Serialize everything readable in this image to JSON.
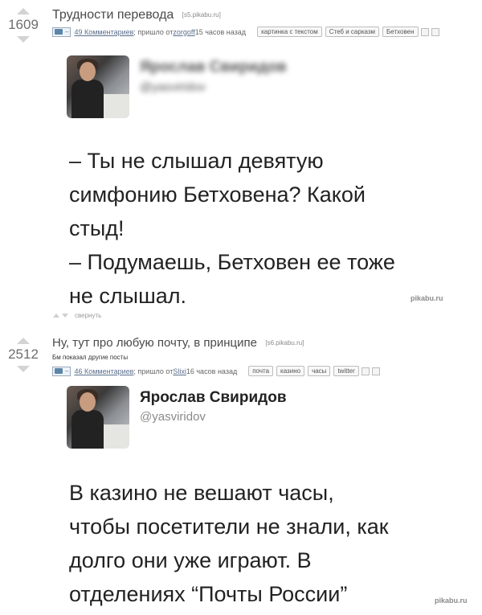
{
  "posts": [
    {
      "rating": "1609",
      "title": "Трудности перевода",
      "source": "[s5.pikabu.ru]",
      "comments": "49 Комментариев",
      "meta_mid": "; пришло от ",
      "author": "zorgoff",
      "time": " 15 часов назад",
      "tags": [
        "картинка с текстом",
        "Стеб и сарказм",
        "Бетховен"
      ],
      "tweet_name": "Ярослав Свиридов",
      "tweet_handle": "@yasviridov",
      "tweet_lines": [
        "– Ты не слышал девятую",
        "симфонию Бетховена? Какой",
        "стыд!",
        "– Подумаешь, Бетховен ее тоже",
        "не слышал."
      ],
      "watermark": "pikabu.ru",
      "collapse": "свернуть"
    },
    {
      "rating": "2512",
      "title": "Ну, тут про любую почту, в принципе",
      "source": "[s6.pikabu.ru]",
      "note": "Бм показал другие посты",
      "comments": "46 Комментариев",
      "meta_mid": "; пришло от ",
      "author": "Slixi",
      "time": " 16 часов назад",
      "tags": [
        "почта",
        "казино",
        "часы",
        "twitter"
      ],
      "tweet_name": "Ярослав Свиридов",
      "tweet_handle": "@yasviridov",
      "tweet_lines": [
        "В казино не вешают часы,",
        "чтобы посетители не знали, как",
        "долго они уже играют. В",
        "отделениях “Почты России”"
      ],
      "watermark": "pikabu.ru"
    }
  ]
}
